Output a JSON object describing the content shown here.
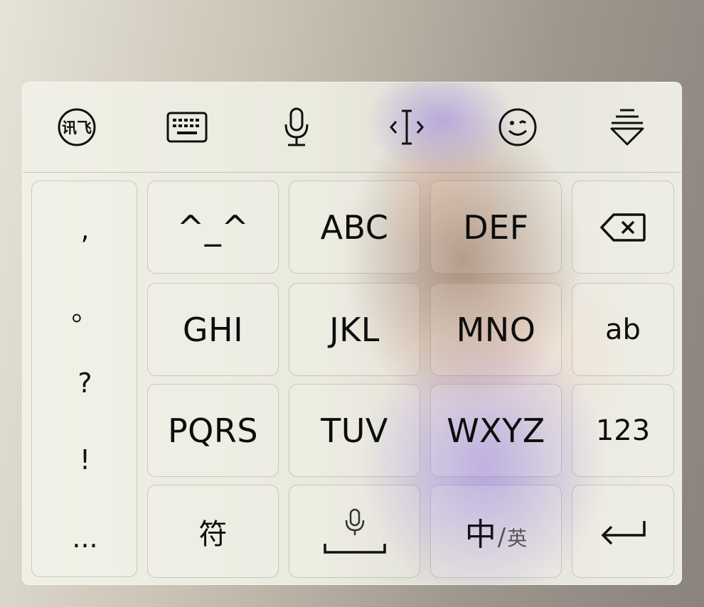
{
  "toolbar": {
    "items": [
      {
        "icon": "ifly-logo-icon",
        "label": "讯飞"
      },
      {
        "icon": "keyboard-icon"
      },
      {
        "icon": "microphone-icon"
      },
      {
        "icon": "cursor-move-icon"
      },
      {
        "icon": "emoji-icon"
      },
      {
        "icon": "hide-keyboard-icon"
      }
    ]
  },
  "punctuation": [
    ",",
    "。",
    "?",
    "!",
    "..."
  ],
  "keys": {
    "emoticon": "^_^",
    "abc": "ABC",
    "def": "DEF",
    "ghi": "GHI",
    "jkl": "JKL",
    "mno": "MNO",
    "ab": "ab",
    "pqrs": "PQRS",
    "tuv": "TUV",
    "wxyz": "WXYZ",
    "num": "123",
    "symbol": "符",
    "lang_zh": "中",
    "lang_sep": "/",
    "lang_en": "英"
  },
  "colors": {
    "text": "#0d0d0d",
    "hair": "#7a4a34",
    "dress": "#9b86d6"
  }
}
